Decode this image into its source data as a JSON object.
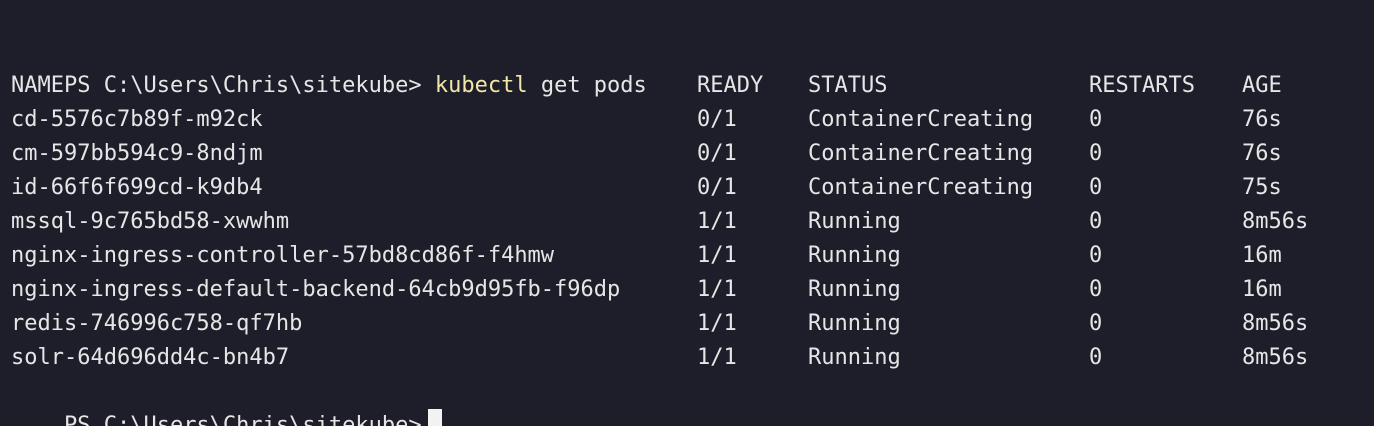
{
  "prompt": "PS C:\\Users\\Chris\\sitekube> ",
  "command": {
    "program": "kubectl",
    "args": " get pods"
  },
  "colors": {
    "background": "#1e1e2a",
    "text": "#e6e6e6",
    "command_highlight": "#f2e7a8"
  },
  "table": {
    "headers": {
      "name": "NAME",
      "ready": "READY",
      "status": "STATUS",
      "restarts": "RESTARTS",
      "age": "AGE"
    },
    "rows": [
      {
        "name": "cd-5576c7b89f-m92ck",
        "ready": "0/1",
        "status": "ContainerCreating",
        "restarts": "0",
        "age": "76s"
      },
      {
        "name": "cm-597bb594c9-8ndjm",
        "ready": "0/1",
        "status": "ContainerCreating",
        "restarts": "0",
        "age": "76s"
      },
      {
        "name": "id-66f6f699cd-k9db4",
        "ready": "0/1",
        "status": "ContainerCreating",
        "restarts": "0",
        "age": "75s"
      },
      {
        "name": "mssql-9c765bd58-xwwhm",
        "ready": "1/1",
        "status": "Running",
        "restarts": "0",
        "age": "8m56s"
      },
      {
        "name": "nginx-ingress-controller-57bd8cd86f-f4hmw",
        "ready": "1/1",
        "status": "Running",
        "restarts": "0",
        "age": "16m"
      },
      {
        "name": "nginx-ingress-default-backend-64cb9d95fb-f96dp",
        "ready": "1/1",
        "status": "Running",
        "restarts": "0",
        "age": "16m"
      },
      {
        "name": "redis-746996c758-qf7hb",
        "ready": "1/1",
        "status": "Running",
        "restarts": "0",
        "age": "8m56s"
      },
      {
        "name": "solr-64d696dd4c-bn4b7",
        "ready": "1/1",
        "status": "Running",
        "restarts": "0",
        "age": "8m56s"
      }
    ]
  },
  "final_prompt": "PS C:\\Users\\Chris\\sitekube>"
}
